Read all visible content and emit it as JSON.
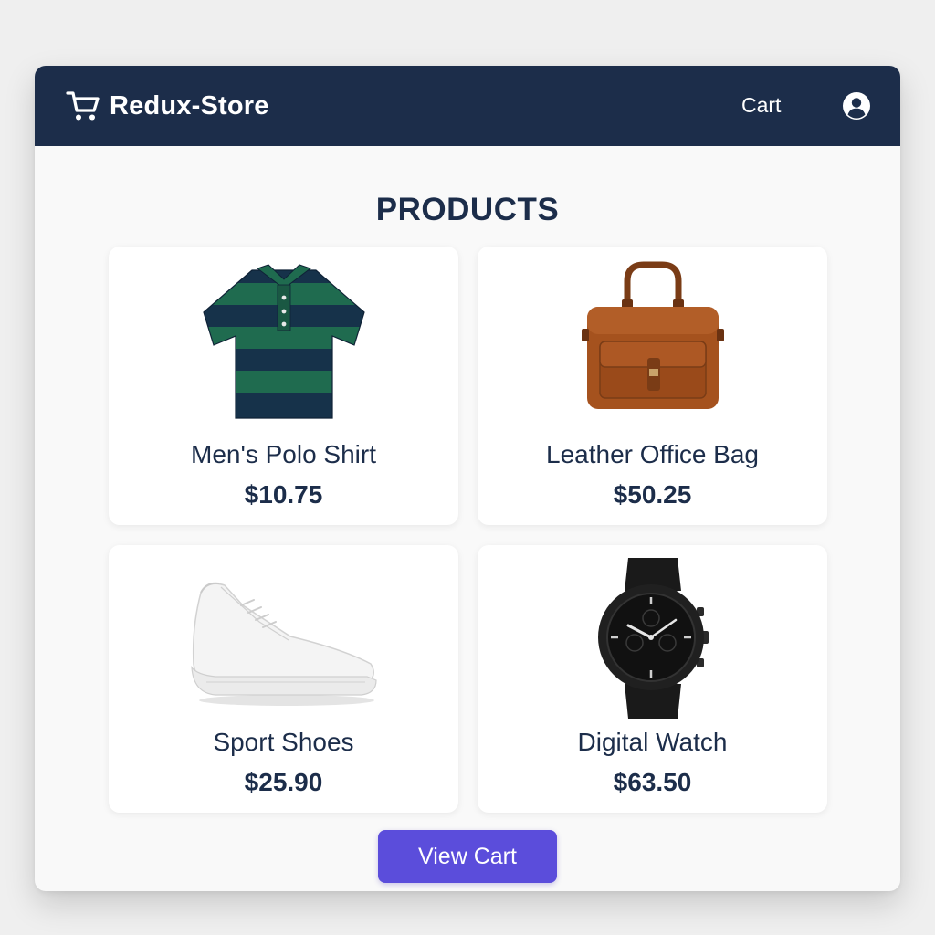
{
  "navbar": {
    "brand": "Redux-Store",
    "brand_icon": "shopping-cart-icon",
    "cart_link": "Cart",
    "account_icon": "user-account-icon"
  },
  "main": {
    "heading": "PRODUCTS",
    "products": [
      {
        "name": "Men's Polo Shirt",
        "price": "$10.75",
        "image": "polo-shirt-image"
      },
      {
        "name": "Leather Office Bag",
        "price": "$50.25",
        "image": "leather-bag-image"
      },
      {
        "name": "Sport Shoes",
        "price": "$25.90",
        "image": "sport-shoe-image"
      },
      {
        "name": "Digital Watch",
        "price": "$63.50",
        "image": "wrist-watch-image"
      }
    ],
    "view_cart_label": "View Cart"
  },
  "colors": {
    "navbar_bg": "#1c2d4a",
    "accent": "#5b4ddb",
    "text": "#1c2d4a",
    "page_bg": "#efefef"
  }
}
